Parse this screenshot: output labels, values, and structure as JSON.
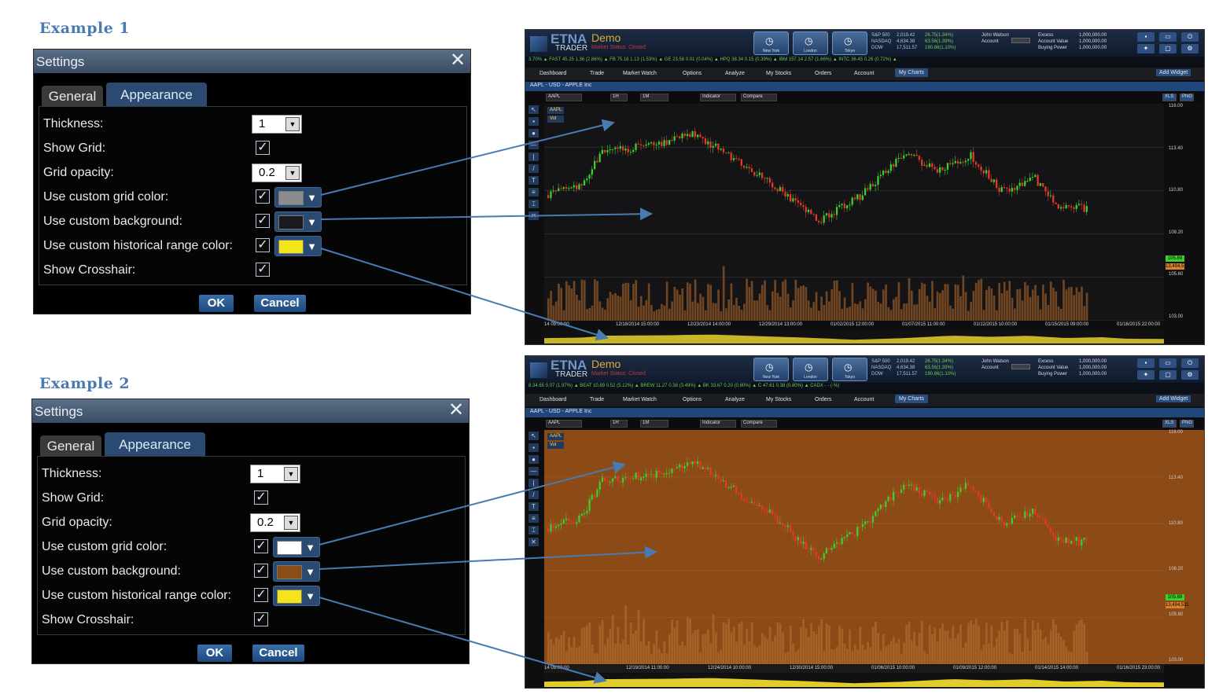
{
  "examples": [
    {
      "title": "Example 1",
      "settings": {
        "title": "Settings",
        "tabs": [
          "General",
          "Appearance"
        ],
        "rows": [
          {
            "label": "Thickness:",
            "type": "select",
            "value": "1"
          },
          {
            "label": "Show Grid:",
            "type": "check",
            "checked": true
          },
          {
            "label": "Grid opacity:",
            "type": "select",
            "value": "0.2"
          },
          {
            "label": "Use custom grid color:",
            "type": "check-color",
            "checked": true,
            "color": "#8c8c8c"
          },
          {
            "label": "Use custom background:",
            "type": "check-color",
            "checked": true,
            "color": "#1a1a1c"
          },
          {
            "label": "Use custom historical range color:",
            "type": "check-color",
            "checked": true,
            "color": "#f4e51a"
          },
          {
            "label": "Show Crosshair:",
            "type": "check",
            "checked": true
          }
        ],
        "ok_label": "OK",
        "cancel_label": "Cancel"
      },
      "chart": {
        "background": "#141416",
        "grid_color": "#5a5a5a",
        "range_color": "#c9b628",
        "demo": "Demo",
        "market_status": "Market Status: Closed",
        "logo_top": "ETNA",
        "logo_bottom": "TRADER",
        "nav_buttons": [
          "New York",
          "London",
          "Tokyo"
        ],
        "quotes_names": "S&P 500\nNASDAQ\nDOW",
        "quotes_values": "2,019.42\n4,634.38\n17,511.57",
        "quotes_changes": "26.75(1.34%)\n63.56(1.39%)\n190.86(1.10%)",
        "user": "John Watson\nAccount",
        "account_labels": "Excess\nAccount Value\nBuying Power",
        "account_values": "1,000,000.00\n1,000,000.00\n1,000,000.00",
        "ticker": "3.70% ▲      FAST 45.25 1.36 (2.86%) ▲            FB 75.18 1.13 (1.53%) ▲            GE 23.58 0.01 (0.04%) ▲            HPQ 38.34 0.15 (0.39%) ▲            IBM 157.14 2.57 (1.66%) ▲            INTC 36.45 0.26 (0.72%) ▲",
        "menu": [
          "Dashboard",
          "Trade",
          "Market Watch",
          "Options",
          "Analyze",
          "My Stocks",
          "Orders",
          "Account",
          "My Charts"
        ],
        "add_widget": "Add Widget",
        "subtitle": "AAPL - USD - APPLE Inc",
        "symbol": "AAPL",
        "interval": "1H",
        "period": "1M",
        "indicator": "Indicator",
        "compare": "Compare",
        "export": [
          "XLS",
          "PNG"
        ],
        "legend": [
          "AAPL",
          "Vol"
        ],
        "y_ticks": [
          "116.00",
          "113.40",
          "110.80",
          "108.20",
          "105.60",
          "103.00"
        ],
        "x_ticks": [
          "14 09:00:00",
          "12/18/2014 15:00:00",
          "12/23/2014 14:00:00",
          "12/29/2014 13:00:00",
          "01/02/2015 12:00:00",
          "01/07/2015 11:00:00",
          "01/12/2015 10:00:00",
          "01/15/2015 09:00:00",
          "01/16/2015 22:00:00"
        ],
        "price_badges": [
          "105.89",
          "13,494,511"
        ]
      }
    },
    {
      "title": "Example 2",
      "settings": {
        "title": "Settings",
        "tabs": [
          "General",
          "Appearance"
        ],
        "rows": [
          {
            "label": "Thickness:",
            "type": "select",
            "value": "1"
          },
          {
            "label": "Show Grid:",
            "type": "check",
            "checked": true
          },
          {
            "label": "Grid opacity:",
            "type": "select",
            "value": "0.2"
          },
          {
            "label": "Use custom grid color:",
            "type": "check-color",
            "checked": true,
            "color": "#ffffff"
          },
          {
            "label": "Use custom background:",
            "type": "check-color",
            "checked": true,
            "color": "#8a4d18"
          },
          {
            "label": "Use custom historical range color:",
            "type": "check-color",
            "checked": true,
            "color": "#f4e51a"
          },
          {
            "label": "Show Crosshair:",
            "type": "check",
            "checked": true
          }
        ],
        "ok_label": "OK",
        "cancel_label": "Cancel"
      },
      "chart": {
        "background": "#8b4a16",
        "grid_color": "#b0703a",
        "range_color": "#e0cc2a",
        "demo": "Demo",
        "market_status": "Market Status: Closed",
        "logo_top": "ETNA",
        "logo_bottom": "TRADER",
        "nav_buttons": [
          "New York",
          "London",
          "Tokyo"
        ],
        "quotes_names": "S&P 500\nNASDAQ\nDOW",
        "quotes_values": "2,019.42\n4,634.38\n17,511.57",
        "quotes_changes": "26.75(1.34%)\n63.56(1.39%)\n190.86(1.10%)",
        "user": "John Watson\nAccount",
        "account_labels": "Excess\nAccount Value\nBuying Power",
        "account_values": "1,000,000.00\n1,000,000.00\n1,000,000.00",
        "ticker": "8.34.65 0.07 (1.97%) ▲              BEAT 10.89 0.52 (5.12%) ▲              BREW 11.27 0.38 (3.49%) ▲              BK 33.67 0.20 (0.60%) ▲              C 47.61 0.38 (0.80%) ▲              CADX - - (-%)",
        "menu": [
          "Dashboard",
          "Trade",
          "Market Watch",
          "Options",
          "Analyze",
          "My Stocks",
          "Orders",
          "Account",
          "My Charts"
        ],
        "add_widget": "Add Widget",
        "subtitle": "AAPL - USD - APPLE Inc",
        "symbol": "AAPL",
        "interval": "1H",
        "period": "1M",
        "indicator": "Indicator",
        "compare": "Compare",
        "export": [
          "XLS",
          "PNG"
        ],
        "legend": [
          "AAPL",
          "Vol"
        ],
        "y_ticks": [
          "116.00",
          "113.40",
          "110.80",
          "108.20",
          "105.60",
          "103.00"
        ],
        "x_ticks": [
          "14 09:00:00",
          "12/19/2014 11:00:00",
          "12/24/2014 10:00:00",
          "12/30/2014 15:00:00",
          "01/06/2015 10:00:00",
          "01/09/2015 12:00:00",
          "01/14/2015 14:00:00",
          "01/16/2015 23:00:00"
        ],
        "price_badges": [
          "105.89",
          "13,494,511"
        ]
      }
    }
  ]
}
